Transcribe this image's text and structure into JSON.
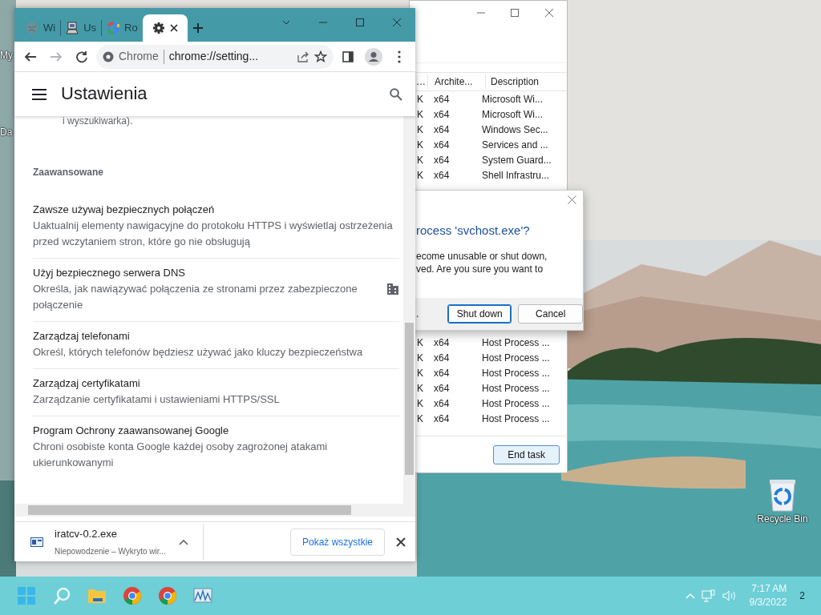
{
  "desktop_labels": [
    {
      "label": "My"
    },
    {
      "label": "Da"
    }
  ],
  "task_manager": {
    "columns": [
      "…",
      "Archite...",
      "Description"
    ],
    "rows_above": [
      {
        "cells": [
          "K",
          "x64",
          "Microsoft Wi..."
        ]
      },
      {
        "cells": [
          "K",
          "x64",
          "Microsoft Wi..."
        ]
      },
      {
        "cells": [
          "K",
          "x64",
          "Windows Sec..."
        ]
      },
      {
        "cells": [
          "K",
          "x64",
          "Services and ..."
        ]
      },
      {
        "cells": [
          "K",
          "x64",
          "System Guard..."
        ]
      },
      {
        "cells": [
          "K",
          "x64",
          "Shell Infrastru..."
        ]
      }
    ],
    "rows_below": [
      {
        "cells": [
          "K",
          "x64",
          "Host Process ..."
        ]
      },
      {
        "cells": [
          "K",
          "x64",
          "Host Process ..."
        ]
      },
      {
        "cells": [
          "K",
          "x64",
          "Host Process ..."
        ]
      },
      {
        "cells": [
          "K",
          "x64",
          "Host Process ..."
        ]
      },
      {
        "cells": [
          "K",
          "x64",
          "Host Process ..."
        ]
      },
      {
        "cells": [
          "K",
          "x64",
          "Host Process ..."
        ]
      }
    ],
    "end_task_button": "End task"
  },
  "dialog": {
    "title": "rocess 'svchost.exe'?",
    "text_lines": [
      "ecome unusable or shut down,",
      "ved. Are you sure you want to"
    ],
    "footer_fragment": ".",
    "buttons": [
      {
        "label": "Shut down",
        "selected": true
      },
      {
        "label": "Cancel",
        "selected": false
      }
    ]
  },
  "browser": {
    "tabs": [
      {
        "kind": "globe",
        "label": "Wi",
        "selected": false
      },
      {
        "kind": "computer",
        "label": "Us",
        "selected": false
      },
      {
        "kind": "google",
        "label": "Ro",
        "selected": false
      },
      {
        "kind": "settings",
        "selected": true
      }
    ],
    "nav_buttons": [
      {
        "kind": "back",
        "disabled": false
      },
      {
        "kind": "forward",
        "disabled": true
      },
      {
        "kind": "reload",
        "disabled": false
      }
    ],
    "omnibox": {
      "site_label": "Chrome",
      "url": "chrome://setting..."
    },
    "settings": {
      "title": "Ustawienia",
      "cut_text": "i wyszukiwarka).",
      "section": "Zaawansowane",
      "items": [
        {
          "kind": "plain",
          "title": "Zawsze używaj bezpiecznych połączeń",
          "description": "Uaktualnij elementy nawigacyjne do protokołu HTTPS i wyświetlaj ostrzeżenia przed wczytaniem stron, które go nie obsługują"
        },
        {
          "kind": "managed",
          "title": "Użyj bezpiecznego serwera DNS",
          "description": "Określa, jak nawiązywać połączenia ze stronami przez zabezpieczone połączenie"
        },
        {
          "kind": "plain",
          "title": "Zarządzaj telefonami",
          "description": "Określ, których telefonów będziesz używać jako kluczy bezpieczeństwa"
        },
        {
          "kind": "plain",
          "title": "Zarządzaj certyfikatami",
          "description": "Zarządzanie certyfikatami i ustawieniami HTTPS/SSL"
        },
        {
          "kind": "plain",
          "title": "Program Ochrony zaawansowanej Google",
          "description": "Chroni osobiste konta Google każdej osoby zagrożonej atakami ukierunkowanymi"
        }
      ]
    },
    "download": {
      "filename": "iratcv-0.2.exe",
      "status": "Niepowodzenie – Wykryto wir...",
      "show_all": "Pokaż wszystkie"
    }
  },
  "recycle_bin": {
    "label": "Recycle Bin"
  },
  "taskbar": {
    "apps": [
      {
        "kind": "start"
      },
      {
        "kind": "search"
      },
      {
        "kind": "folder"
      },
      {
        "kind": "chrome"
      },
      {
        "kind": "chrome"
      },
      {
        "kind": "monitor"
      }
    ],
    "clock": {
      "time": "7:17 AM",
      "date": "9/3/2022"
    },
    "notification_count": "2"
  }
}
